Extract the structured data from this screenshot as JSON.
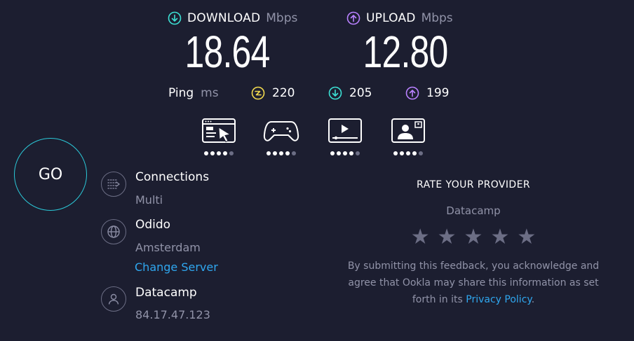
{
  "download": {
    "label": "DOWNLOAD",
    "unit": "Mbps",
    "value": "18.64",
    "color": "#3ce0d4"
  },
  "upload": {
    "label": "UPLOAD",
    "unit": "Mbps",
    "value": "12.80",
    "color": "#b981ff"
  },
  "ping": {
    "label": "Ping",
    "unit": "ms",
    "idle": "220",
    "download": "205",
    "upload": "199",
    "idle_color": "#f2d94e"
  },
  "quality_icons": [
    {
      "icon": "web-browsing-icon",
      "dots_on": 4,
      "dots_total": 5
    },
    {
      "icon": "gaming-icon",
      "dots_on": 4,
      "dots_total": 5
    },
    {
      "icon": "video-streaming-icon",
      "dots_on": 4,
      "dots_total": 5
    },
    {
      "icon": "video-chat-icon",
      "dots_on": 4,
      "dots_total": 5
    }
  ],
  "go": {
    "label": "GO",
    "ring_color": "#2bc9d8"
  },
  "connections": {
    "title": "Connections",
    "value": "Multi"
  },
  "server": {
    "name": "Odido",
    "location": "Amsterdam",
    "change_link": "Change Server"
  },
  "provider": {
    "name": "Datacamp",
    "ip": "84.17.47.123"
  },
  "rate": {
    "title": "RATE YOUR PROVIDER",
    "provider": "Datacamp",
    "stars_total": 5,
    "disclaimer_line1": "By submitting this feedback, you acknowledge and",
    "disclaimer_line2": "agree that Ookla may share this information as set",
    "disclaimer_line3_prefix": "forth in its ",
    "privacy_link": "Privacy Policy",
    "disclaimer_line3_suffix": "."
  }
}
